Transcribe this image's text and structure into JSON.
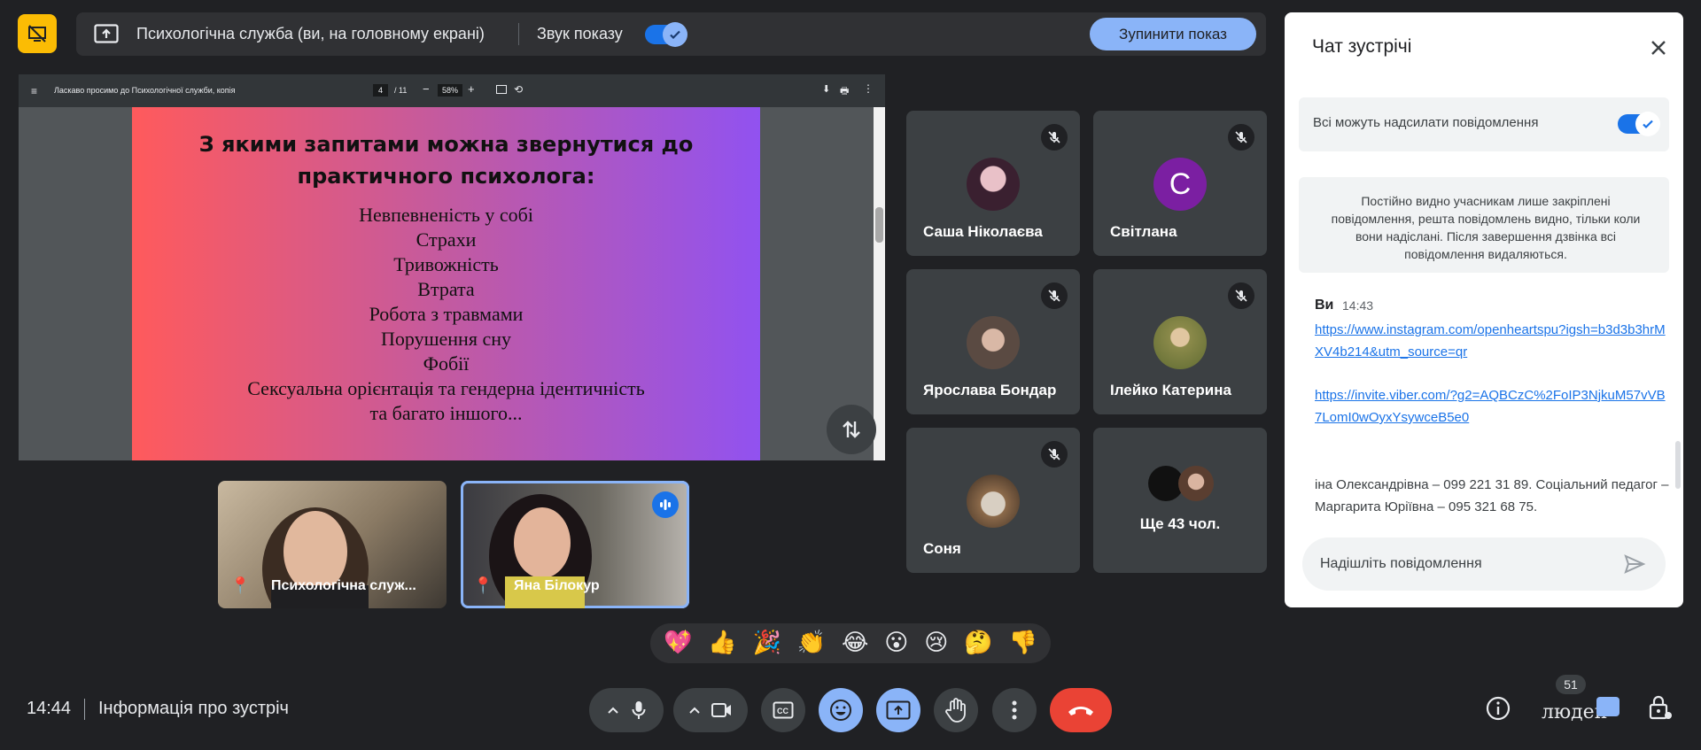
{
  "presenting": {
    "title": "Психологічна служба (ви, на головному екрані)",
    "audio_label": "Звук показу",
    "audio_on": true,
    "stop_label": "Зупинити показ"
  },
  "pdf_viewer": {
    "doc_title": "Ласкаво просимо до Психологічної служби, копія",
    "page": "4",
    "page_total": "/ 11",
    "zoom": "58%",
    "minus": "−",
    "plus": "+",
    "rotate": "⟲",
    "download": "⬇",
    "print": "🖶",
    "more": "⋮",
    "menu": "≡"
  },
  "slide": {
    "title_line1": "З якими запитами можна звернутися до",
    "title_line2": "практичного психолога:",
    "items": [
      "Невпевненість у собі",
      "Страхи",
      "Тривожність",
      "Втрата",
      "Робота з травмами",
      "Порушення сну",
      "Фобії",
      "Сексуальна орієнтація та гендерна ідентичність",
      "та багато іншого..."
    ]
  },
  "participants": {
    "tiles": [
      {
        "name": "Саша Ніколаєва",
        "muted": true
      },
      {
        "name": "Світлана",
        "muted": true,
        "avatar_letter": "С"
      },
      {
        "name": "Ярослава Бондар",
        "muted": true
      },
      {
        "name": "Ілейко Катерина",
        "muted": true
      },
      {
        "name": "Соня",
        "muted": true
      },
      {
        "name": "Ще 43 чол."
      }
    ],
    "video": [
      {
        "name": "Психологічна служ..."
      },
      {
        "name": "Яна Білокур",
        "speaking": true
      }
    ]
  },
  "chat": {
    "title": "Чат зустрічі",
    "permission_label": "Всі можуть надсилати повідомлення",
    "permission_on": true,
    "notice": "Постійно видно учасникам лише закріплені повідомлення, решта повідомлень видно, тільки коли вони надіслані. Після завершення дзвінка всі повідомлення видаляються.",
    "message": {
      "sender": "Ви",
      "time": "14:43",
      "link1": "https://www.instagram.com/openheartspu?igsh=b3d3b3hrMXV4b214&utm_source=qr",
      "link2": "https://invite.viber.com/?g2=AQBCzC%2FoIP3NjkuM57vVB7LomI0wOyxYsywceB5e0",
      "text": "іна Олександрівна – 099 221 31 89. Соціальний педагог – Маргарита Юріївна – 095 321 68 75."
    },
    "input_placeholder": "Надішліть повідомлення"
  },
  "reactions": [
    "💖",
    "👍",
    "🎉",
    "👏",
    "😂",
    "😮",
    "😢",
    "🤔",
    "👎"
  ],
  "bottom": {
    "time": "14:44",
    "meeting_info": "Інформація про зустріч",
    "people_count": "51",
    "people_label": "люден"
  },
  "colors": {
    "background": "#202124",
    "accent_blue": "#8ab4f8",
    "leave_red": "#ea4335",
    "present_yellow": "#fbbc04"
  }
}
